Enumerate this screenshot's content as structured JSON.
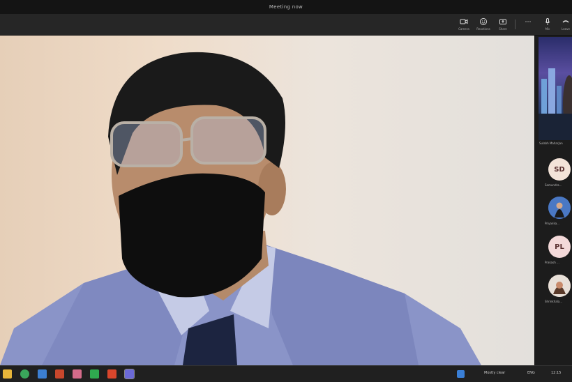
{
  "window": {
    "title": "Meeting now"
  },
  "toolbar": {
    "buttons": [
      {
        "label": "Camera",
        "icon": "camera-icon"
      },
      {
        "label": "Reactions",
        "icon": "smile-icon"
      },
      {
        "label": "Share",
        "icon": "share-icon"
      },
      {
        "label": "",
        "icon": "more-icon"
      },
      {
        "label": "Mic",
        "icon": "mic-icon"
      },
      {
        "label": "Leave",
        "icon": "leave-icon"
      }
    ]
  },
  "participants": {
    "featured_name": "Sulabh Maharjan",
    "tiles": [
      {
        "initials": "SD",
        "name": "Samundra...",
        "color": "#f3e3d8"
      },
      {
        "initials": "",
        "name": "Priyanka...",
        "color": "#3a6ab8"
      },
      {
        "initials": "PL",
        "name": "Prakash ...",
        "color": "#f3d9d9"
      },
      {
        "initials": "",
        "name": "Shrinkhala...",
        "color": "#d9b9a8"
      }
    ]
  },
  "taskbar": {
    "apps": [
      {
        "name": "file-explorer-icon",
        "color": "#e8b63a"
      },
      {
        "name": "chrome-icon",
        "color": "#3aa65b"
      },
      {
        "name": "store-icon",
        "color": "#3c7fd1"
      },
      {
        "name": "powerpoint-icon",
        "color": "#c8472c"
      },
      {
        "name": "photos-icon",
        "color": "#d46b8a"
      },
      {
        "name": "teams-icon",
        "color": "#2fa84f"
      },
      {
        "name": "media-icon",
        "color": "#d9462c"
      },
      {
        "name": "teams-meeting-icon",
        "color": "#6b69d6"
      }
    ],
    "weather": "Mostly clear",
    "language": "ENG",
    "time": "12:15"
  }
}
